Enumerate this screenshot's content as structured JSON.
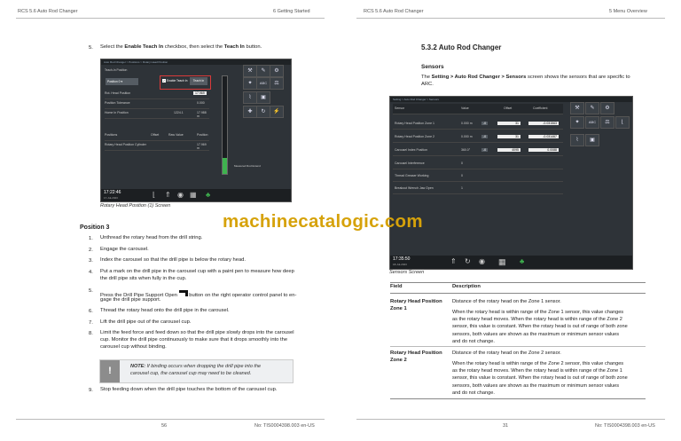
{
  "left_page": {
    "header_left": "RCS 5.6 Auto Rod Changer",
    "header_right": "6 Getting Started",
    "step5_num": "5.",
    "step5": [
      "Select the ",
      "Enable Teach In",
      " checkbox, then select the ",
      "Teach In",
      " button."
    ],
    "screen": {
      "title": "Auto Rod Changer > Positions > Rotary Head Position",
      "teach_heading": "Teach-In Position",
      "dropdown": "Position 0",
      "enable_label": "Enable Teach In",
      "teach_button": "Teach In",
      "field1": "Rot. Head Position",
      "field1_val": "17.969",
      "field2": "Position Tolerance",
      "field2_val": "0.000",
      "field3": "Home In Position",
      "field3_val": "1224.1",
      "field3_val2": "17.988 m",
      "col_positions": "Positions",
      "col_offset": "Offset",
      "col_rawvalue": "Raw Value",
      "col_position": "Position",
      "row1": "Rotary Head Position Cylinder",
      "row1_val": "17.969 m",
      "gauge_label": "Measured Rod Extend",
      "time": "17:22:46",
      "date": "17-Jul-2023"
    },
    "caption": "Rotary Head Position (1) Screen",
    "position_heading": "Position 3",
    "steps": [
      {
        "n": "1.",
        "t": "Unthread the rotary head from the drill string."
      },
      {
        "n": "2.",
        "t": "Engage the carousel."
      },
      {
        "n": "3.",
        "t": "Index the carousel so that the drill pipe is below the rotary head."
      },
      {
        "n": "4.",
        "t": "Put a mark on the drill pipe in the carousel cup with a paint pen to measure how deep",
        "t2": "the drill pipe sits when fully in the cup."
      },
      {
        "n": "5.",
        "t": "Press the Drill Pipe Support Open",
        "t_after": "button on the right operator control panel to en-",
        "t2": "gage the drill pipe support."
      },
      {
        "n": "6.",
        "t": "Thread the rotary head onto the drill pipe in the carousel."
      },
      {
        "n": "7.",
        "t": "Lift the drill pipe out of the carousel cup."
      },
      {
        "n": "8.",
        "t": "Limit the feed force and feed down so that the drill pipe slowly drops into the carousel",
        "t2": "cup. Monitor the drill pipe continuously to make sure that it drops smoothly into the",
        "t3": "carousel cup without binding."
      },
      {
        "n": "9.",
        "t": "Stop feeding down when the drill pipe touches the bottom of the carousel cup."
      }
    ],
    "note_label": "NOTE:",
    "note_text1": " If binding occurs when dropping the drill pipe into the",
    "note_text2": "carousel cup, the carousel cup may need to be cleaned.",
    "note_icon": "!",
    "footer_page": "56",
    "footer_doc": "No: TIS0004398.003 en-US"
  },
  "right_page": {
    "header_left": "RCS 5.6 Auto Rod Changer",
    "header_right": "5 Menu Overview",
    "section": "5.3.2 Auto Rod Changer",
    "subheading": "Sensors",
    "intro1_a": "The ",
    "intro1_b": "Setting > Auto Rod Changer > Sensors",
    "intro1_c": " screen shows the sensors that are specific to",
    "intro2": "ARC.",
    "screen": {
      "title": "Setting > Auto Rod Changer > Sensors",
      "col_sensor": "Sensor",
      "col_value": "Value",
      "col_offset": "Offset",
      "col_coeff": "Coefficient",
      "rows": [
        {
          "name": "Rotary Head Position Zone 1",
          "value": "0.000 m",
          "offset": "31",
          "coeff": "-0.031563"
        },
        {
          "name": "Rotary Head Position Zone 2",
          "value": "0.000 m",
          "offset": "31",
          "coeff": "-0.031467"
        },
        {
          "name": "Carousel Index Position",
          "value": "360.0°",
          "offset": "4095",
          "coeff": "0.0088"
        },
        {
          "name": "Carousel Interference",
          "value": "0",
          "offset": "",
          "coeff": ""
        },
        {
          "name": "Thread Greaser Working",
          "value": "0",
          "offset": "",
          "coeff": ""
        },
        {
          "name": "Breakout Wrench Jaw Open",
          "value": "1",
          "offset": "",
          "coeff": ""
        }
      ],
      "abc": "ABC",
      "time": "17:35:50",
      "date": "18-Jul-2023"
    },
    "caption": "Sensors Screen",
    "table": {
      "col1": "Field",
      "col2": "Description",
      "r1_field1": "Rotary Head Position",
      "r1_field2": "Zone 1",
      "r1_d1": "Distance of the rotary head on the Zone 1 sensor.",
      "r1_d2": "When the rotary head is within range of the Zone 1 sensor, this value changes",
      "r1_d3": "as the rotary head moves. When the rotary head is within range of the Zone 2",
      "r1_d4": "sensor, this value is constant. When the rotary head is out of range of both zone",
      "r1_d5": "sensors, both values are shown as the maximum or minimum sensor values",
      "r1_d6": "and do not change.",
      "r2_field1": "Rotary Head Position",
      "r2_field2": "Zone 2",
      "r2_d1": "Distance of the rotary head on the Zone 2 sensor.",
      "r2_d2": "When the rotary head is within range of the Zone 2 sensor, this value changes",
      "r2_d3": "as the rotary head moves. When the rotary head is within range of the Zone 1",
      "r2_d4": "sensor, this value is constant. When the rotary head is out of range of both zone",
      "r2_d5": "sensors, both values are shown as the maximum or minimum sensor values",
      "r2_d6": "and do not change."
    },
    "footer_page": "31",
    "footer_doc": "No: TIS0004398.003 en-US"
  },
  "watermark": "machinecatalogic.com",
  "colors": {
    "accent": "#2d6fb7",
    "highlight": "#d93a3a",
    "watermark": "#d6a20a",
    "screen_bg": "#2e3338"
  }
}
